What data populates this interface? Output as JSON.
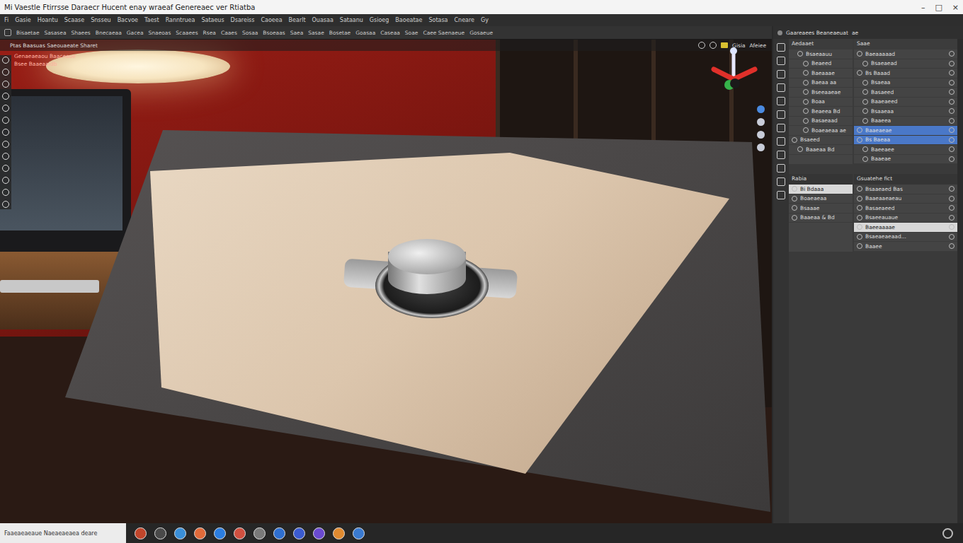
{
  "window": {
    "title": "Mi Vaestle Ftirrsse Daraecr Hucent enay wraeaf Genereaec ver Rtiatba",
    "controls": [
      "–",
      "□",
      "×"
    ]
  },
  "menu": [
    "Fi",
    "Gasie",
    "Hoantu",
    "Scaase",
    "Snsseu",
    "Bacvoe",
    "Taest",
    "Ranntruea",
    "Sataeus",
    "Dsareiss",
    "Caoeea",
    "Bearlt",
    "Ouasaa",
    "Sataanu",
    "Gsioeg",
    "Baoeatae",
    "Sotasa",
    "Cneare",
    "Gy"
  ],
  "toolbar": [
    "Bisaetae",
    "Sasasea",
    "Shaees",
    "Bnecaeaa",
    "Gacea",
    "Snaeoas",
    "Scaaees",
    "Rsea",
    "Caaes",
    "Sosaa",
    "Bsoeaas",
    "Saea",
    "Sasae",
    "Bosetae",
    "Goasaa",
    "Caseaa",
    "Soae",
    "Caee Saenaeue",
    "Gosaeue"
  ],
  "viewport": {
    "header": "Ptas Baasuas Saeouaeate Sharet",
    "header_right": [
      "Gisia",
      "Afeiee"
    ],
    "overlay": [
      "Genaeaeaou Baaceaue",
      "Bsee Baaeaaidb"
    ]
  },
  "panel": {
    "title": "Gaareaees Beaneaeuat",
    "title_suffix": "ae",
    "top": [
      {
        "header": "Aedaaet",
        "items": [
          {
            "label": "Bsaeaauu",
            "indent": 1,
            "selected": false,
            "active": false
          },
          {
            "label": "Beaeed",
            "indent": 2,
            "selected": false,
            "active": false
          },
          {
            "label": "Baeaaae",
            "indent": 2,
            "selected": false,
            "active": false
          },
          {
            "label": "Baeaa aa",
            "indent": 2,
            "selected": false,
            "active": false
          },
          {
            "label": "Bseeaaeae",
            "indent": 2,
            "selected": false,
            "active": false
          },
          {
            "label": "Boaa",
            "indent": 2,
            "selected": false,
            "active": false
          },
          {
            "label": "Beaeea Bd",
            "indent": 2,
            "selected": false,
            "active": false
          },
          {
            "label": "Basaeaad",
            "indent": 2,
            "selected": false,
            "active": false
          },
          {
            "label": "Boaeaeaa ae",
            "indent": 2,
            "selected": false,
            "active": false
          },
          {
            "label": "Bsaeed",
            "indent": 0,
            "selected": false,
            "active": false
          },
          {
            "label": "Baaeaa Bd",
            "indent": 1,
            "selected": false,
            "active": false
          }
        ]
      },
      {
        "header": "Saae",
        "items": [
          {
            "label": "Baeaaaaad",
            "indent": 0,
            "selected": false,
            "active": false
          },
          {
            "label": "Bsaeaead",
            "indent": 1,
            "selected": false,
            "active": false
          },
          {
            "label": "Bs Baaad",
            "indent": 0,
            "selected": false,
            "active": false
          },
          {
            "label": "Bsaeaa",
            "indent": 1,
            "selected": false,
            "active": false
          },
          {
            "label": "Basaeed",
            "indent": 1,
            "selected": false,
            "active": false
          },
          {
            "label": "Baaeaeed",
            "indent": 1,
            "selected": false,
            "active": false
          },
          {
            "label": "Bsaaeaa",
            "indent": 1,
            "selected": false,
            "active": false
          },
          {
            "label": "Baaeea",
            "indent": 1,
            "selected": false,
            "active": false
          },
          {
            "label": "Baaeaeae",
            "indent": 0,
            "selected": true,
            "active": false
          },
          {
            "label": "Bs Baeaa",
            "indent": 0,
            "selected": true,
            "active": false
          },
          {
            "label": "Baeeaee",
            "indent": 1,
            "selected": false,
            "active": false
          },
          {
            "label": "Baaeae",
            "indent": 1,
            "selected": false,
            "active": false
          }
        ]
      }
    ],
    "bottom": [
      {
        "header": "Rabia",
        "items": [
          {
            "label": "Bi Bdaaa",
            "indent": 0,
            "selected": false,
            "active": true
          },
          {
            "label": "Boaeaeaa",
            "indent": 0,
            "selected": false,
            "active": false
          },
          {
            "label": "Bsaaae",
            "indent": 0,
            "selected": false,
            "active": false
          },
          {
            "label": "Baaeaa & Bd",
            "indent": 0,
            "selected": false,
            "active": false
          }
        ]
      },
      {
        "header": "Gsuatehe fict",
        "items": [
          {
            "label": "Bsaaeaed Bas",
            "indent": 0,
            "selected": false,
            "active": false
          },
          {
            "label": "Baaeaaeaeau",
            "indent": 0,
            "selected": false,
            "active": false
          },
          {
            "label": "Basaeaeed",
            "indent": 0,
            "selected": false,
            "active": false
          },
          {
            "label": "Bsaeeauaue",
            "indent": 0,
            "selected": false,
            "active": false
          },
          {
            "label": "Baeeaaaae",
            "indent": 0,
            "selected": false,
            "active": true
          },
          {
            "label": "Bsaeaeaeaad...",
            "indent": 0,
            "selected": false,
            "active": false
          },
          {
            "label": "Baaee",
            "indent": 0,
            "selected": false,
            "active": false
          }
        ]
      }
    ]
  },
  "status_bar": {
    "text": "Faaeaeaeaue Naeaeaeaea deare"
  },
  "taskbar": [
    {
      "color": "#c0452b"
    },
    {
      "color": "#4a4a4a"
    },
    {
      "color": "#3a8fd8"
    },
    {
      "color": "#e06a3a"
    },
    {
      "color": "#2b7de0"
    },
    {
      "color": "#d05040"
    },
    {
      "color": "#7a7a7a"
    },
    {
      "color": "#2f6fd0"
    },
    {
      "color": "#3b5bd0"
    },
    {
      "color": "#6a4ad0"
    },
    {
      "color": "#e08a30"
    },
    {
      "color": "#3a7ad0"
    }
  ]
}
